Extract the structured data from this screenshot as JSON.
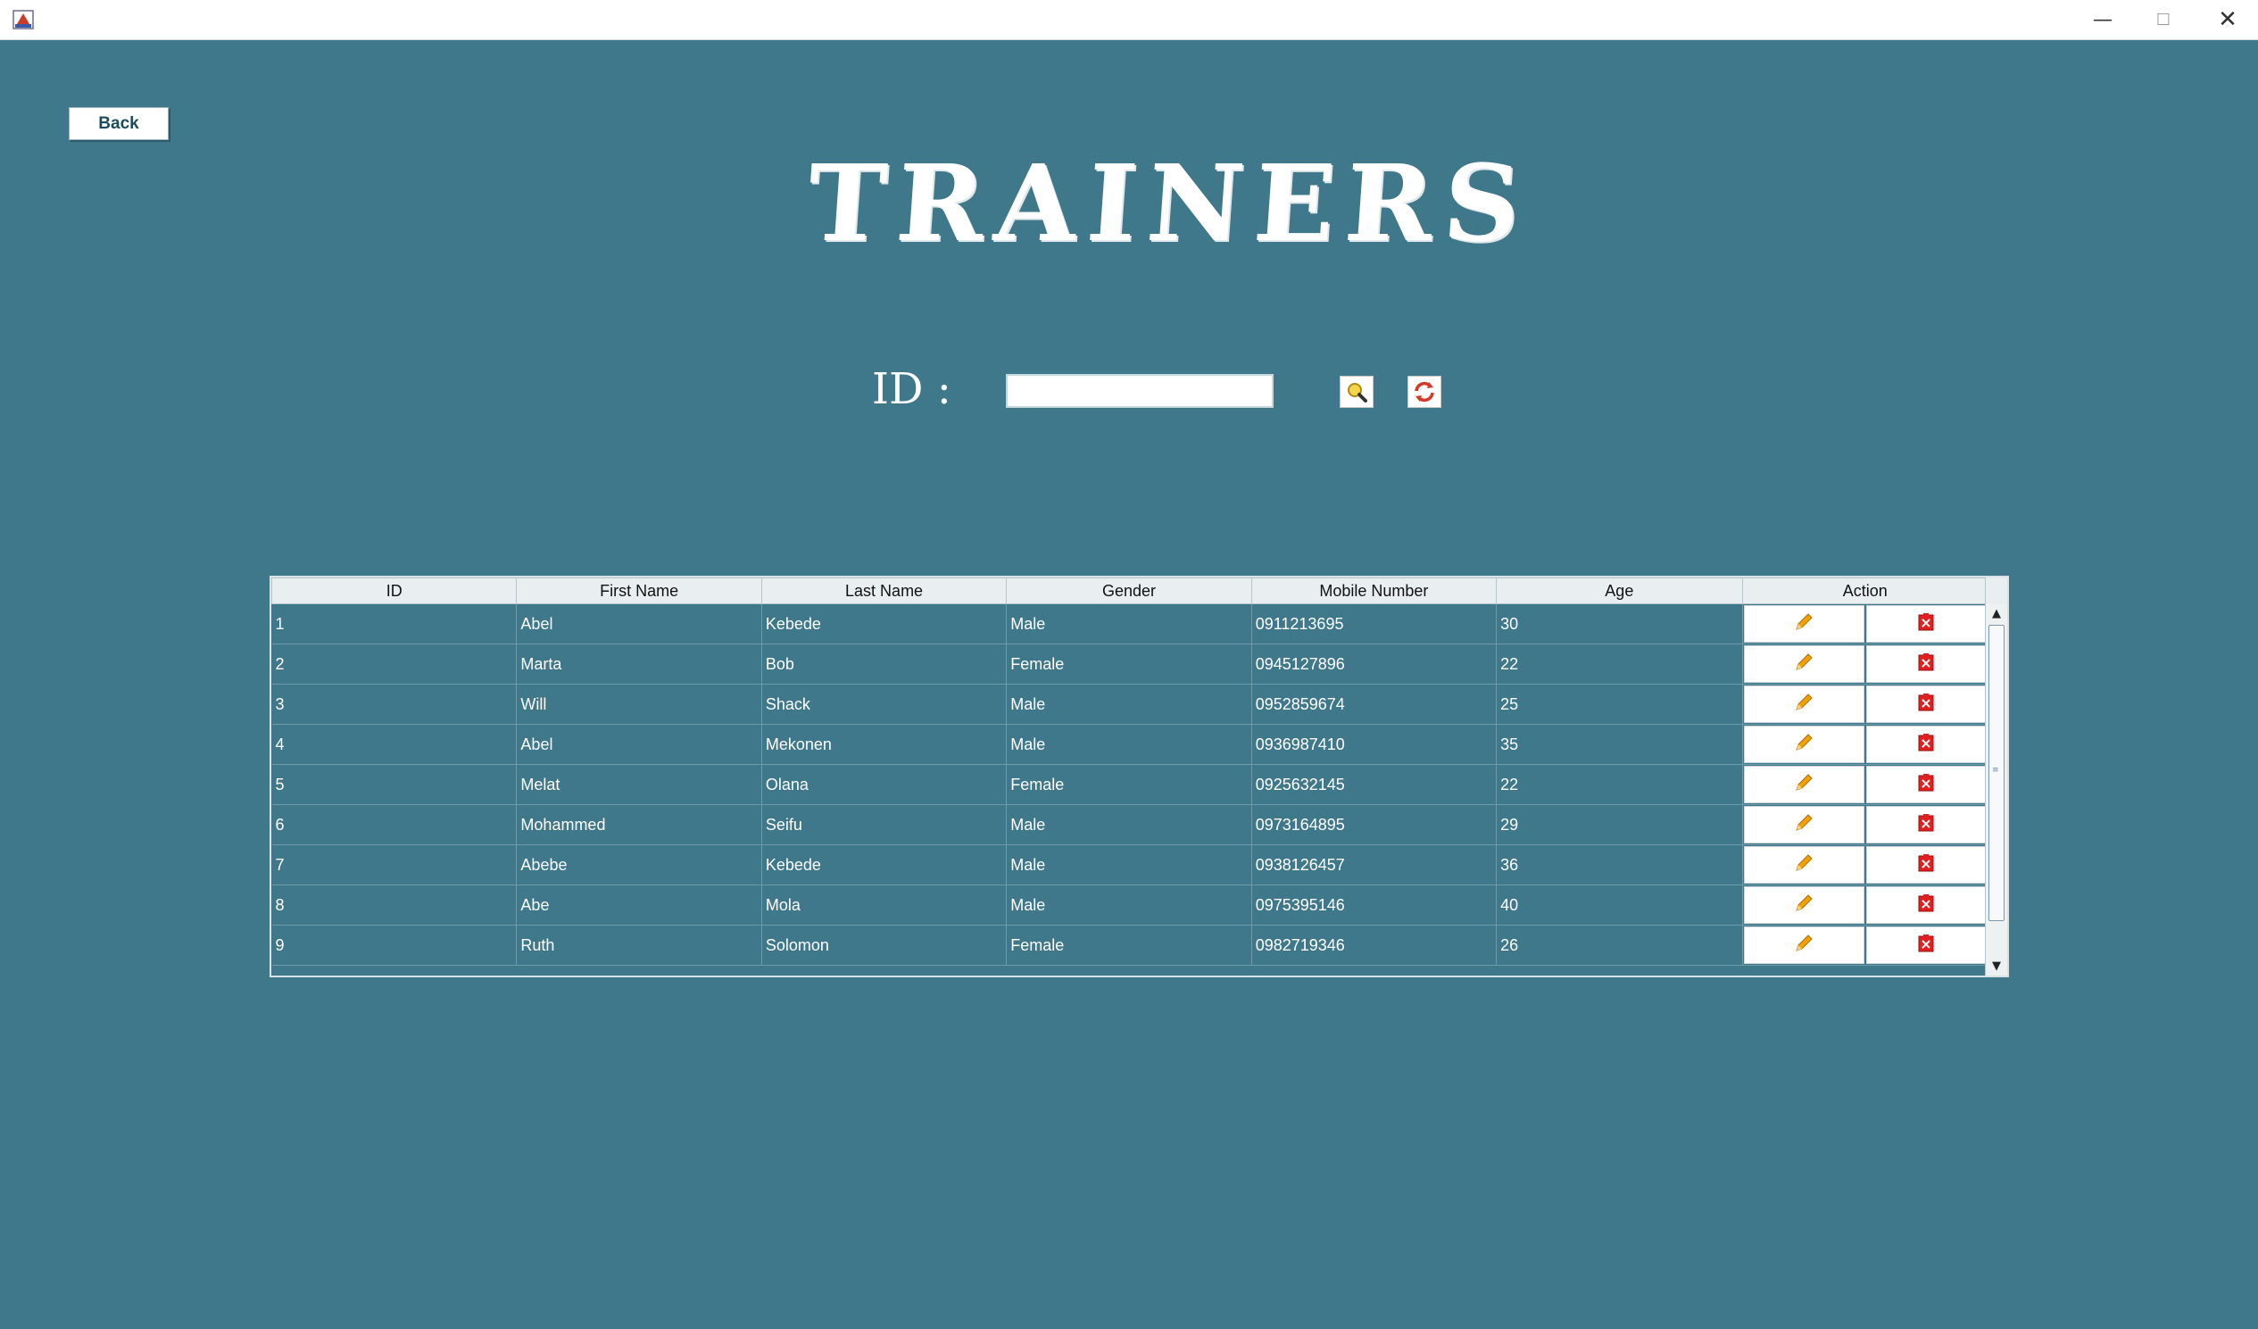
{
  "window": {
    "minimize_glyph": "—",
    "maximize_glyph": "☐",
    "close_glyph": "✕"
  },
  "nav": {
    "back_label": "Back"
  },
  "header": {
    "title": "TRAINERS"
  },
  "search": {
    "label": "ID :",
    "value": ""
  },
  "table": {
    "columns": [
      "ID",
      "First Name",
      "Last Name",
      "Gender",
      "Mobile Number",
      "Age",
      "Action"
    ],
    "rows": [
      [
        "1",
        "Abel",
        "Kebede",
        "Male",
        "0911213695",
        "30"
      ],
      [
        "2",
        "Marta",
        "Bob",
        "Female",
        "0945127896",
        "22"
      ],
      [
        "3",
        "Will",
        "Shack",
        "Male",
        "0952859674",
        "25"
      ],
      [
        "4",
        "Abel",
        "Mekonen",
        "Male",
        "0936987410",
        "35"
      ],
      [
        "5",
        "Melat",
        "Olana",
        "Female",
        "0925632145",
        "22"
      ],
      [
        "6",
        "Mohammed",
        "Seifu",
        "Male",
        "0973164895",
        "29"
      ],
      [
        "7",
        "Abebe",
        "Kebede",
        "Male",
        "0938126457",
        "36"
      ],
      [
        "8",
        "Abe",
        "Mola",
        "Male",
        "0975395146",
        "40"
      ],
      [
        "9",
        "Ruth",
        "Solomon",
        "Female",
        "0982719346",
        "26"
      ]
    ]
  },
  "icons": {
    "edit": "pencil-icon",
    "delete": "delete-icon",
    "search": "search-icon",
    "refresh": "refresh-icon"
  },
  "colors": {
    "background": "#3f788a",
    "edit_icon": "#f0a000",
    "delete_icon": "#e02020"
  }
}
